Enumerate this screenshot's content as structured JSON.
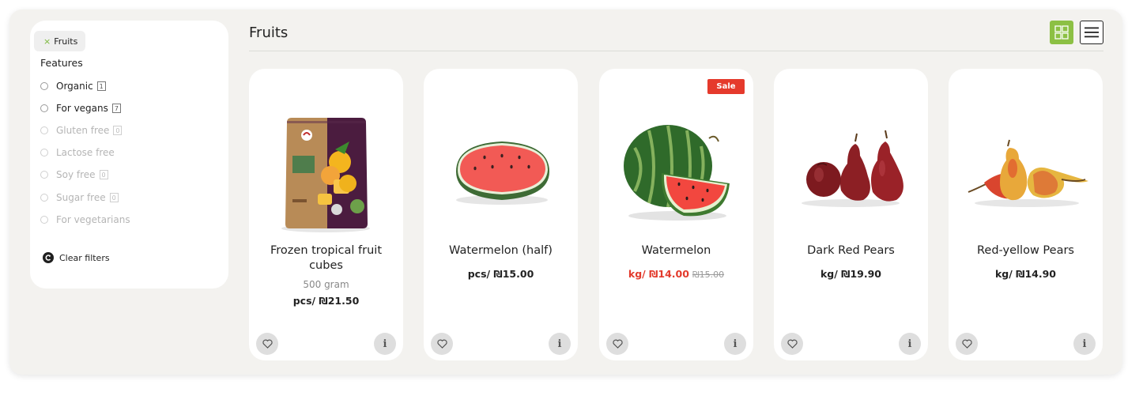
{
  "filters": {
    "active_chip": {
      "label": "Fruits",
      "remove_icon": "×"
    },
    "features_title": "Features",
    "features": [
      {
        "label": "Organic",
        "count": "1",
        "enabled": true
      },
      {
        "label": "For vegans",
        "count": "7",
        "enabled": true
      },
      {
        "label": "Gluten free",
        "count": "0",
        "enabled": false
      },
      {
        "label": "Lactose free",
        "count": "",
        "enabled": false
      },
      {
        "label": "Soy free",
        "count": "0",
        "enabled": false
      },
      {
        "label": "Sugar free",
        "count": "0",
        "enabled": false
      },
      {
        "label": "For vegetarians",
        "count": "",
        "enabled": false
      }
    ],
    "clear_label": "Clear filters"
  },
  "header": {
    "title": "Fruits",
    "view_modes": [
      {
        "name": "grid-view-icon",
        "active": true
      },
      {
        "name": "list-view-icon",
        "active": false
      }
    ]
  },
  "products": [
    {
      "name": "Frozen tropical fruit cubes",
      "weight": "500 gram",
      "price": "pcs/ ₪21.50",
      "old_price": "",
      "sale": false,
      "badge": "",
      "icon": "fruit-bag-image"
    },
    {
      "name": "Watermelon (half)",
      "weight": "",
      "price": "pcs/ ₪15.00",
      "old_price": "",
      "sale": false,
      "badge": "",
      "icon": "half-watermelon-image"
    },
    {
      "name": "Watermelon",
      "weight": "",
      "price": "kg/ ₪14.00",
      "old_price": "₪15.00",
      "sale": true,
      "badge": "Sale",
      "icon": "watermelon-image"
    },
    {
      "name": "Dark Red Pears",
      "weight": "",
      "price": "kg/ ₪19.90",
      "old_price": "",
      "sale": false,
      "badge": "",
      "icon": "red-pears-image"
    },
    {
      "name": "Red-yellow Pears",
      "weight": "",
      "price": "kg/ ₪14.90",
      "old_price": "",
      "sale": false,
      "badge": "",
      "icon": "yellow-pears-image"
    }
  ],
  "colors": {
    "accent": "#8cc044",
    "sale": "#e53a2c",
    "background": "#f3f2ef"
  }
}
